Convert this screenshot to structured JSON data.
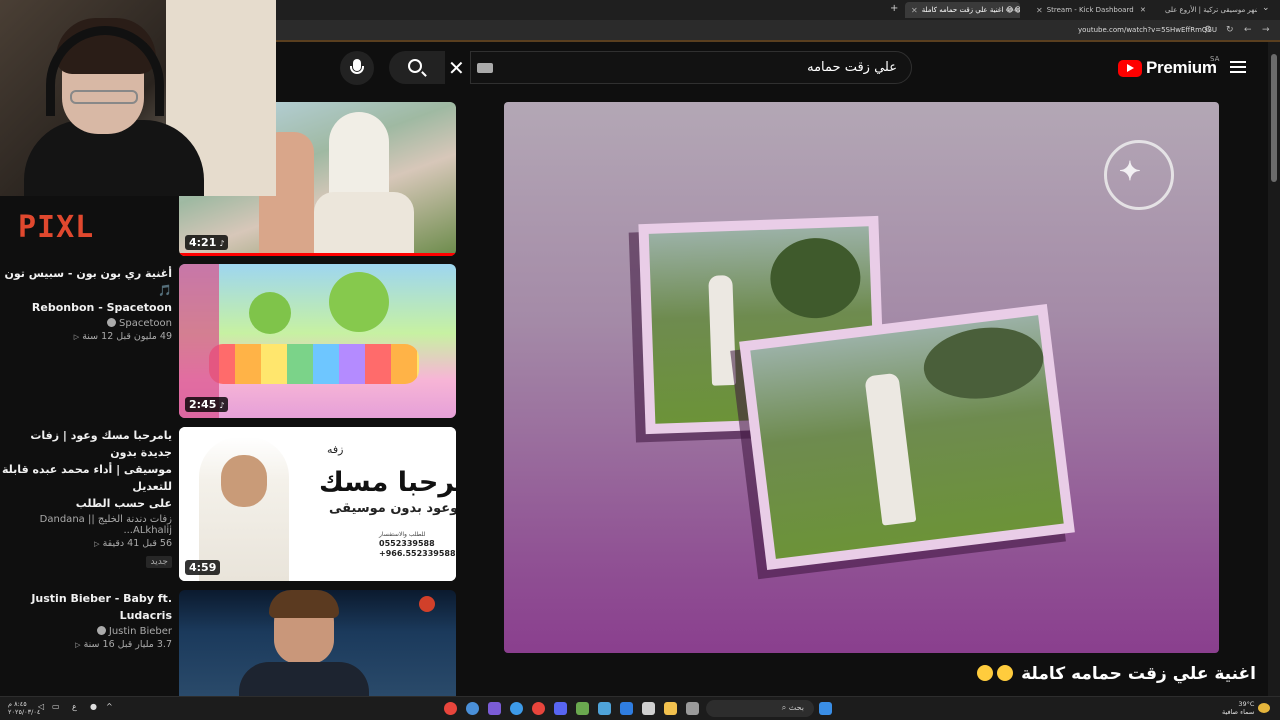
{
  "browser": {
    "tabs": [
      {
        "label": "أشهر موسيقى تركية | الأروع على...",
        "color": "#ff0000"
      },
      {
        "label": "Stream - Kick Dashboard",
        "color": "#53fc18"
      },
      {
        "label": "اغنية علي زقت حمامه كاملة 😂😂",
        "color": "#ff0000"
      }
    ],
    "url": "youtube.com/watch?v=5SHwEffRmQSU"
  },
  "header": {
    "logo_text": "Premium",
    "region": "SA",
    "search_query": "علي زقت حمامه"
  },
  "player": {
    "video_title": "اغنية علي زقت حمامه كاملة"
  },
  "sidebar": {
    "items": [
      {
        "duration": "4:21",
        "progress_fraction": 1.0,
        "thumb_colors": [
          "#b7d3e6",
          "#6b8b4a"
        ]
      },
      {
        "title_line1": "أغنية ري بون بون - سبيس تون 🎵",
        "title_line2": "Rebonbon - Spacetoon",
        "channel": "Spacetoon",
        "stats": "49 مليون  قبل 12 سنة",
        "duration": "2:45",
        "thumb_colors": [
          "#a9e37a",
          "#f49bc8"
        ]
      },
      {
        "title_line1": "يامرحبا مسك وعود | زفات جديدة بدون",
        "title_line2": "موسيقى | أداء محمد عبده  قابلة للتعديل",
        "title_line3": "على حسب الطلب",
        "channel": "زفات دندنة الخليج || Dandana ALkhalij...",
        "stats": "56  قبل 41 دقيقة",
        "badge": "جديد",
        "duration": "4:59",
        "thumb_text_main": "يامرحبا مسك",
        "thumb_text_sub": "وعود بدون موسيقى",
        "thumb_text_tag": "زفه",
        "thumb_phone1": "0552339588",
        "thumb_phone2": "+966.552339588",
        "thumb_contact": "للطلب والاستفسار"
      },
      {
        "title_line1": "Justin Bieber - Baby ft.",
        "title_line2": "Ludacris",
        "channel": "Justin Bieber",
        "stats": "3.7 مليار  قبل 16 سنة"
      }
    ]
  },
  "overlay": {
    "brand": "PIXL"
  },
  "taskbar": {
    "search_placeholder": "بحث",
    "time": "٨:٤٥ م",
    "date": "٢٠٢٥/٠٣/٠٤",
    "weather_temp": "39°C",
    "weather_desc": "سماء صافية",
    "lang": "ع"
  }
}
